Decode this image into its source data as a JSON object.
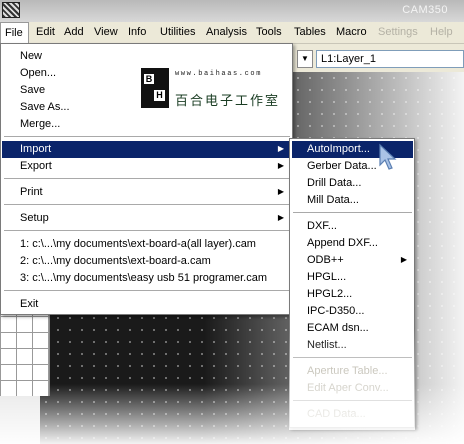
{
  "window": {
    "title": "CAM350"
  },
  "menubar": {
    "items": [
      {
        "label": "File",
        "enabled": true
      },
      {
        "label": "Edit",
        "enabled": true
      },
      {
        "label": "Add",
        "enabled": true
      },
      {
        "label": "View",
        "enabled": true
      },
      {
        "label": "Info",
        "enabled": true
      },
      {
        "label": "Utilities",
        "enabled": true
      },
      {
        "label": "Analysis",
        "enabled": true
      },
      {
        "label": "Tools",
        "enabled": true
      },
      {
        "label": "Tables",
        "enabled": true
      },
      {
        "label": "Macro",
        "enabled": true
      },
      {
        "label": "Settings",
        "enabled": false
      },
      {
        "label": "Help",
        "enabled": false
      }
    ]
  },
  "toolbar": {
    "layer_value": "L1:Layer_1"
  },
  "file_menu": {
    "items": [
      {
        "label": "New"
      },
      {
        "label": "Open..."
      },
      {
        "label": "Save"
      },
      {
        "label": "Save As..."
      },
      {
        "label": "Merge..."
      },
      {
        "label": "Import",
        "submenu": true,
        "selected": true
      },
      {
        "label": "Export",
        "submenu": true
      },
      {
        "label": "Print",
        "submenu": true
      },
      {
        "label": "Setup",
        "submenu": true
      },
      {
        "label": "1: c:\\...\\my documents\\ext-board-a(all layer).cam"
      },
      {
        "label": "2: c:\\...\\my documents\\ext-board-a.cam"
      },
      {
        "label": "3: c:\\...\\my documents\\easy usb 51 programer.cam"
      },
      {
        "label": "Exit"
      }
    ],
    "logo": {
      "url": "www.baihaas.com",
      "cn_text": "百合电子工作室",
      "b": "B",
      "h": "H"
    }
  },
  "import_submenu": {
    "items": [
      {
        "label": "AutoImport...",
        "selected": true
      },
      {
        "label": "Gerber Data..."
      },
      {
        "label": "Drill Data..."
      },
      {
        "label": "Mill Data..."
      },
      {
        "label": "DXF..."
      },
      {
        "label": "Append DXF..."
      },
      {
        "label": "ODB++",
        "submenu": true
      },
      {
        "label": "HPGL..."
      },
      {
        "label": "HPGL2..."
      },
      {
        "label": "IPC-D350..."
      },
      {
        "label": "ECAM dsn..."
      },
      {
        "label": "Netlist..."
      },
      {
        "label": "Aperture Table...",
        "enabled": false
      },
      {
        "label": "Edit Aper Conv...",
        "enabled": false
      },
      {
        "label": "CAD Data...",
        "enabled": false
      }
    ]
  },
  "colors": {
    "menu_highlight": "#0a246a",
    "menubar_bg": "#ece9d8",
    "disabled_text": "#aca899",
    "canvas_bg": "#1a1a1a"
  }
}
